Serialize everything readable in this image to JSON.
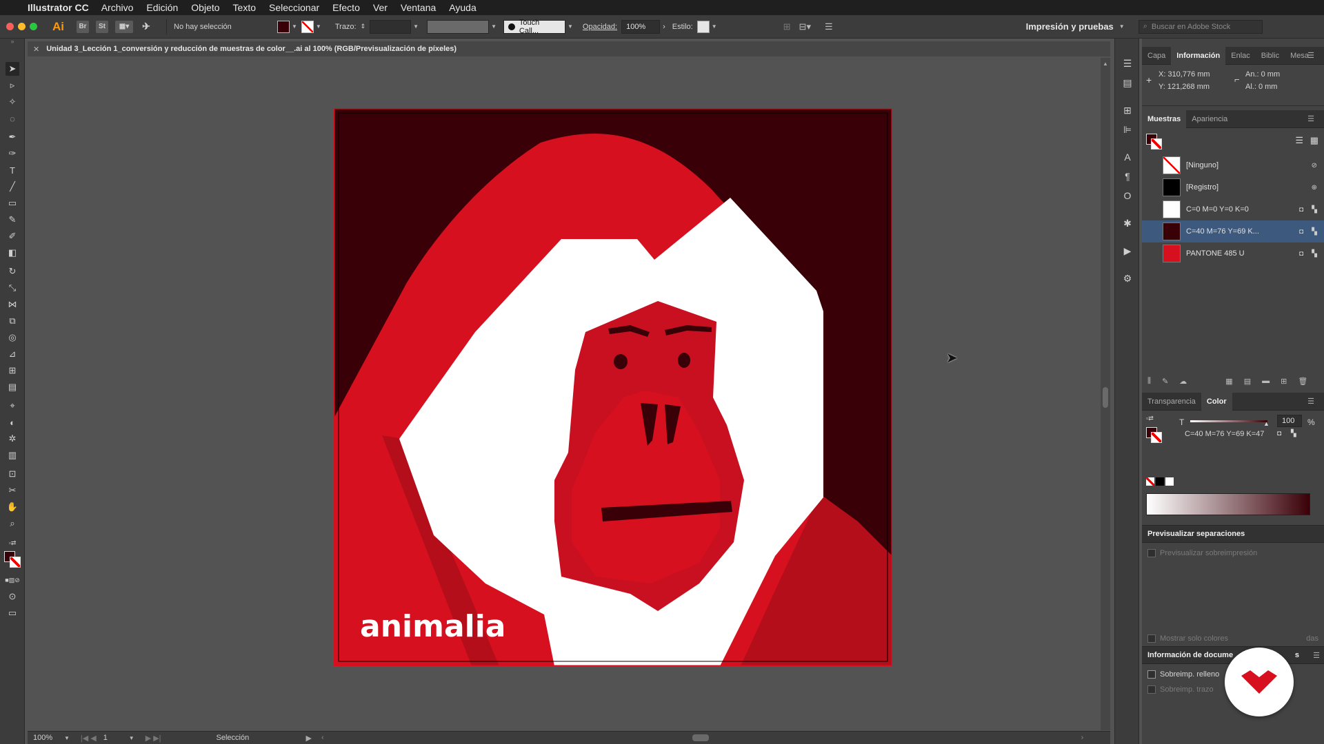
{
  "menubar": {
    "app_name": "Illustrator CC",
    "items": [
      "Archivo",
      "Edición",
      "Objeto",
      "Texto",
      "Seleccionar",
      "Efecto",
      "Ver",
      "Ventana",
      "Ayuda"
    ]
  },
  "controlbar": {
    "ai_logo": "Ai",
    "br_label": "Br",
    "st_label": "St",
    "selection_status": "No hay selección",
    "stroke_label": "Trazo:",
    "brush_name": "Touch Call...",
    "opacity_label": "Opacidad:",
    "opacity_value": "100%",
    "style_label": "Estilo:",
    "workspace": "Impresión y pruebas",
    "stock_search_placeholder": "Buscar en Adobe Stock"
  },
  "document": {
    "tab_title": "Unidad 3_Lección 1_conversión y reducción de muestras de color__.ai al 100% (RGB/Previsualización de píxeles)",
    "artwork_text": "animalia"
  },
  "statusbar": {
    "zoom": "100%",
    "page": "1",
    "tool": "Selección"
  },
  "info_panel": {
    "tabs": [
      "Capa",
      "Información",
      "Enlac",
      "Biblic",
      "Mesa"
    ],
    "x": "X: 310,776 mm",
    "y": "Y: 121,268 mm",
    "w": "An.: 0 mm",
    "h": "Al.: 0 mm"
  },
  "swatches_panel": {
    "tabs": [
      "Muestras",
      "Apariencia"
    ],
    "items": [
      {
        "name": "[Ninguno]",
        "color": "none"
      },
      {
        "name": "[Registro]",
        "color": "#000000"
      },
      {
        "name": "C=0 M=0 Y=0 K=0",
        "color": "#ffffff"
      },
      {
        "name": "C=40 M=76 Y=69 K...",
        "color": "#3a0008"
      },
      {
        "name": "PANTONE 485 U",
        "color": "#d6101f"
      }
    ]
  },
  "color_panel": {
    "tabs": [
      "Transparencia",
      "Color"
    ],
    "tint_label": "T",
    "tint_value": "100",
    "percent": "%",
    "color_name": "C=40 M=76 Y=69 K=47"
  },
  "separations_panel": {
    "title": "Previsualizar separaciones",
    "overprint_preview": "Previsualizar sobreimpresión",
    "show_only_used": "Mostrar solo colores",
    "show_only_used_tail": "das"
  },
  "doc_info_panel": {
    "title": "Información de docume",
    "title_tail": "s",
    "overprint_fill": "Sobreimp. relleno",
    "overprint_stroke": "Sobreimp. trazo"
  },
  "colors": {
    "dark_red": "#3a0008",
    "pantone_red": "#d6101f",
    "shade_red": "#b50e1b",
    "face_red": "#c81020",
    "white": "#ffffff"
  }
}
